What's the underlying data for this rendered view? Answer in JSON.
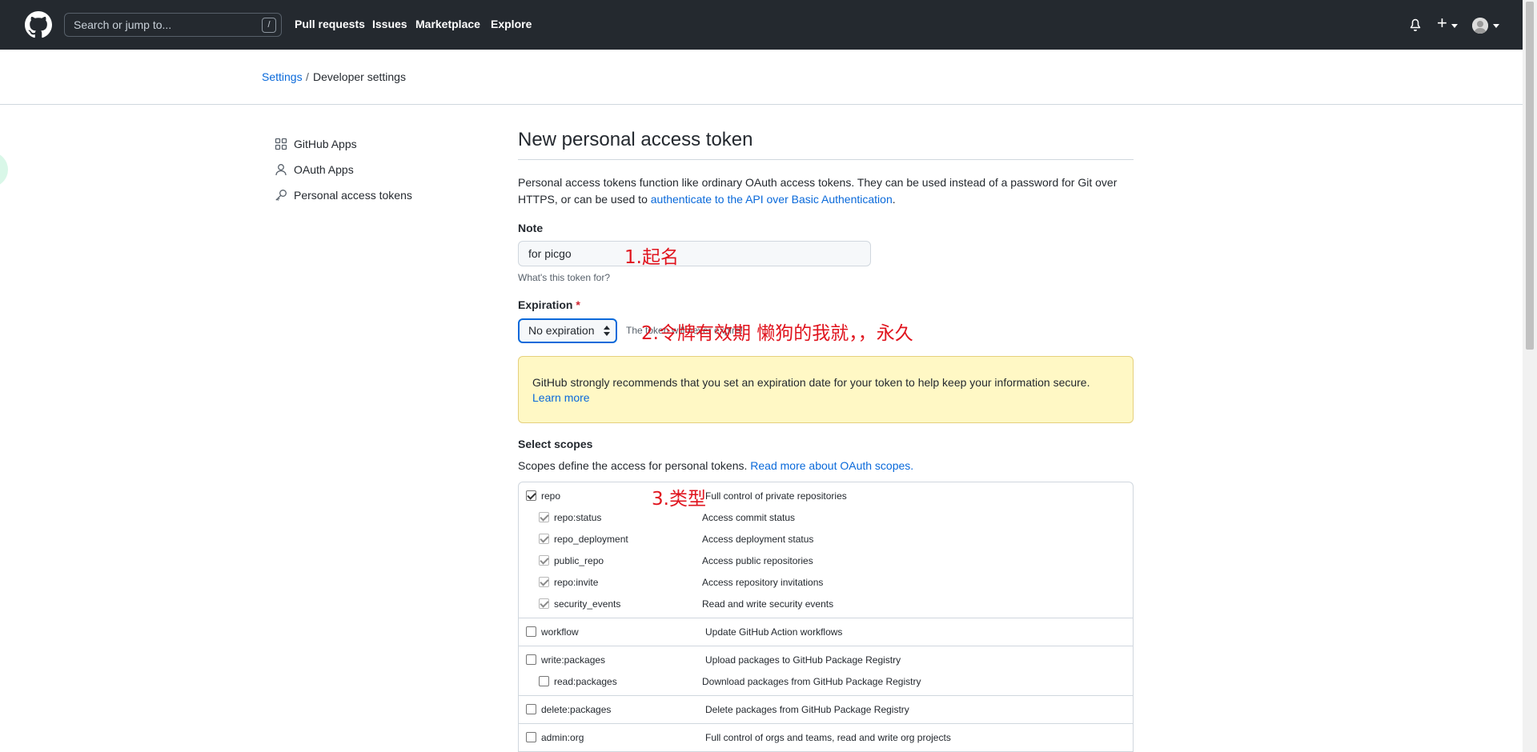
{
  "header": {
    "search_placeholder": "Search or jump to...",
    "search_shortcut": "/",
    "nav": [
      "Pull requests",
      "Issues",
      "Marketplace",
      "Explore"
    ],
    "plus_label": "+"
  },
  "breadcrumb": {
    "parent": "Settings",
    "separator": "/",
    "current": "Developer settings"
  },
  "sidebar": {
    "items": [
      {
        "label": "GitHub Apps",
        "icon": "apps-icon"
      },
      {
        "label": "OAuth Apps",
        "icon": "person-icon"
      },
      {
        "label": "Personal access tokens",
        "icon": "key-icon"
      }
    ]
  },
  "main": {
    "title": "New personal access token",
    "intro_text": "Personal access tokens function like ordinary OAuth access tokens. They can be used instead of a password for Git over HTTPS, or can be used to ",
    "intro_link": "authenticate to the API over Basic Authentication",
    "intro_end": ".",
    "note": {
      "label": "Note",
      "value": "for picgo",
      "hint": "What's this token for?"
    },
    "expiration": {
      "label": "Expiration",
      "required_mark": "*",
      "selected": "No expiration",
      "note": "The token will never expire!"
    },
    "flash": {
      "text": "GitHub strongly recommends that you set an expiration date for your token to help keep your information secure.",
      "link": "Learn more"
    },
    "scopes": {
      "title": "Select scopes",
      "desc": "Scopes define the access for personal tokens. ",
      "desc_link": "Read more about OAuth scopes.",
      "groups": [
        {
          "rows": [
            {
              "kind": "parent",
              "name": "repo",
              "desc": "Full control of private repositories",
              "checked": true
            },
            {
              "kind": "child",
              "name": "repo:status",
              "desc": "Access commit status",
              "checked": true
            },
            {
              "kind": "child",
              "name": "repo_deployment",
              "desc": "Access deployment status",
              "checked": true
            },
            {
              "kind": "child",
              "name": "public_repo",
              "desc": "Access public repositories",
              "checked": true
            },
            {
              "kind": "child",
              "name": "repo:invite",
              "desc": "Access repository invitations",
              "checked": true
            },
            {
              "kind": "child",
              "name": "security_events",
              "desc": "Read and write security events",
              "checked": true
            }
          ]
        },
        {
          "rows": [
            {
              "kind": "parent",
              "name": "workflow",
              "desc": "Update GitHub Action workflows",
              "checked": false
            }
          ]
        },
        {
          "rows": [
            {
              "kind": "parent",
              "name": "write:packages",
              "desc": "Upload packages to GitHub Package Registry",
              "checked": false
            },
            {
              "kind": "child",
              "name": "read:packages",
              "desc": "Download packages from GitHub Package Registry",
              "checked": false
            }
          ]
        },
        {
          "rows": [
            {
              "kind": "parent",
              "name": "delete:packages",
              "desc": "Delete packages from GitHub Package Registry",
              "checked": false
            }
          ]
        },
        {
          "rows": [
            {
              "kind": "parent",
              "name": "admin:org",
              "desc": "Full control of orgs and teams, read and write org projects",
              "checked": false
            }
          ]
        }
      ]
    }
  },
  "annotations": {
    "a1": "1.起名",
    "a2": "2.令牌有效期  懒狗的我就，，永久",
    "a3": "3.类型"
  },
  "colors": {
    "header_bg": "#24292f",
    "link": "#0969da",
    "annotation": "#e0141e",
    "flash_bg": "#fff8c5"
  }
}
